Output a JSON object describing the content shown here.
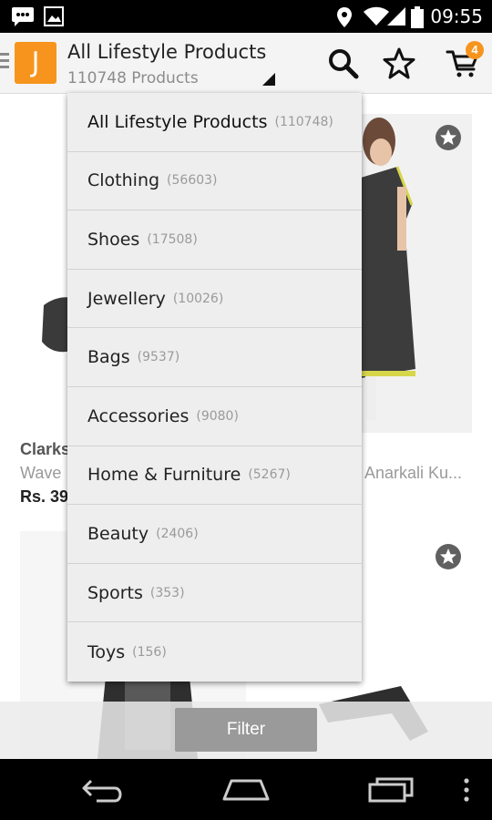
{
  "status_bar": {
    "time": "09:55"
  },
  "action_bar": {
    "logo_letter": "J",
    "title": "All Lifestyle Products",
    "subtitle": "110748 Products",
    "cart_count": "4"
  },
  "dropdown": {
    "items": [
      {
        "label": "All Lifestyle Products",
        "count": "(110748)"
      },
      {
        "label": "Clothing",
        "count": "(56603)"
      },
      {
        "label": "Shoes",
        "count": "(17508)"
      },
      {
        "label": "Jewellery",
        "count": "(10026)"
      },
      {
        "label": "Bags",
        "count": "(9537)"
      },
      {
        "label": "Accessories",
        "count": "(9080)"
      },
      {
        "label": "Home & Furniture",
        "count": "(5267)"
      },
      {
        "label": "Beauty",
        "count": "(2406)"
      },
      {
        "label": "Sports",
        "count": "(353)"
      },
      {
        "label": "Toys",
        "count": "(156)"
      }
    ]
  },
  "products": [
    {
      "brand": "Clarks",
      "name": "Wave",
      "price": "Rs. 39"
    },
    {
      "brand": "",
      "name": "Anarkali Ku...",
      "price": ""
    }
  ],
  "filter": {
    "label": "Filter"
  },
  "colors": {
    "accent": "#f7941d",
    "filter_button": "#9a9a9a"
  }
}
